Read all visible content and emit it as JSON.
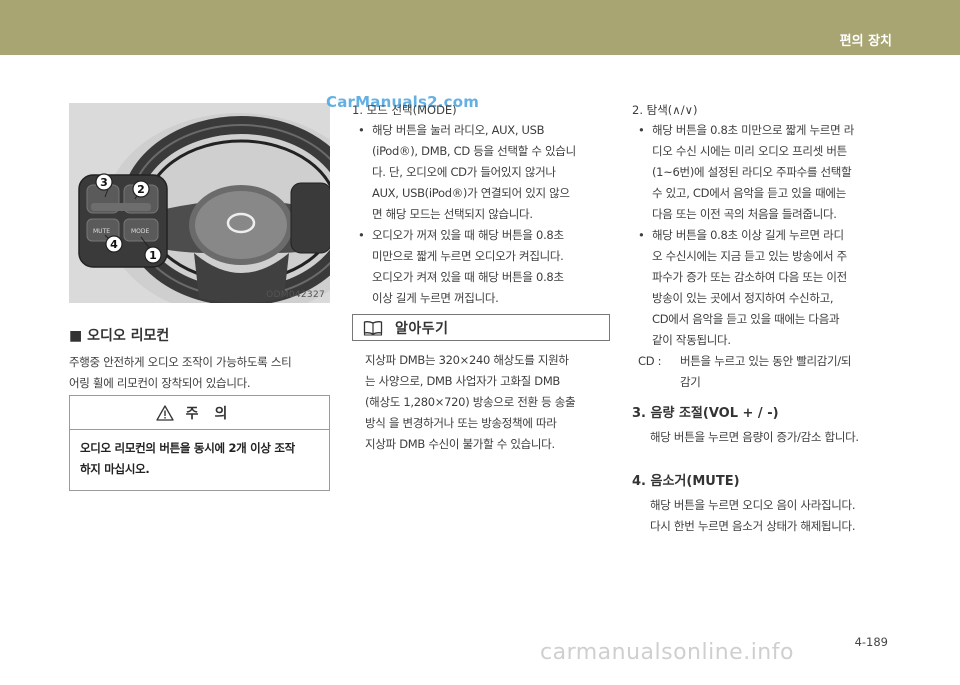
{
  "header": {
    "title": "편의 장치"
  },
  "figure": {
    "code": "ODM042327",
    "callouts": [
      "1",
      "2",
      "3",
      "4"
    ],
    "button_labels": [
      "MUTE",
      "MODE"
    ]
  },
  "watermark_top": "CarManuals2.com",
  "left": {
    "section_title": "■ 오디오 리모컨",
    "desc": [
      "주행중 안전하게 오디오 조작이 가능하도록 스티",
      "어링 휠에 리모컨이 장착되어 있습니다."
    ],
    "caution": {
      "label": "주의",
      "text": [
        "오디오 리모컨의 버튼을 동시에 2개 이상 조작",
        "하지 마십시오."
      ]
    }
  },
  "mid": {
    "item1_title": "1. 모드 선택(MODE)",
    "bullet_char": "•",
    "bullet1": [
      "해당 버튼을 눌러 라디오, AUX, USB",
      "(iPod®), DMB, CD 등을 선택할 수 있습니",
      "다. 단, 오디오에 CD가 들어있지 않거나",
      "AUX, USB(iPod®)가 연결되어 있지 않으",
      "면 해당 모드는 선택되지 않습니다."
    ],
    "bullet2": [
      "오디오가 꺼져 있을 때 해당 버튼을 0.8초",
      "미만으로 짧게 누르면 오디오가 켜집니다.",
      "오디오가 켜져 있을 때 해당 버튼을 0.8초",
      "이상 길게 누르면 꺼집니다."
    ],
    "note_label": "알아두기",
    "note_text": [
      "지상파 DMB는 320×240 해상도를 지원하",
      "는 사양으로, DMB 사업자가 고화질 DMB",
      "(해상도 1,280×720) 방송으로 전환 등 송출",
      "방식 을 변경하거나 또는 방송정책에 따라",
      "지상파 DMB 수신이 불가할 수 있습니다."
    ]
  },
  "right": {
    "item2_title": "2. 탐색(∧/∨)",
    "bullet1": [
      "해당 버튼을 0.8초 미만으로 짧게 누르면 라",
      "디오 수신 시에는 미리 오디오 프리셋 버튼",
      "(1~6번)에 설정된 라디오 주파수를 선택할",
      "수 있고, CD에서 음악을 듣고 있을 때에는",
      "다음 또는 이전 곡의 처음을 들려줍니다."
    ],
    "bullet2": [
      "해당 버튼을 0.8초 이상 길게 누르면 라디",
      "오 수신시에는 지금 듣고 있는 방송에서 주",
      "파수가 증가 또는 감소하여 다음 또는 이전",
      "방송이 있는 곳에서 정지하여 수신하고,",
      "CD에서 음악을 듣고 있을 때에는 다음과",
      "같이 작동됩니다."
    ],
    "cd_label": "CD :",
    "cd_text": [
      "버튼을 누르고 있는 동안 빨리감기/되",
      "감기"
    ],
    "item3_title": "3. 음량 조절(VOL + / -)",
    "item3_text": "해당 버튼을 누르면 음량이 증가/감소 합니다.",
    "item4_title": "4. 음소거(MUTE)",
    "item4_text": [
      "해당 버튼을 누르면 오디오 음이 사라집니다.",
      "다시 한번 누르면 음소거 상태가 해제됩니다."
    ]
  },
  "page_number": "4-189",
  "watermark_bottom": "carmanualsonline.info"
}
